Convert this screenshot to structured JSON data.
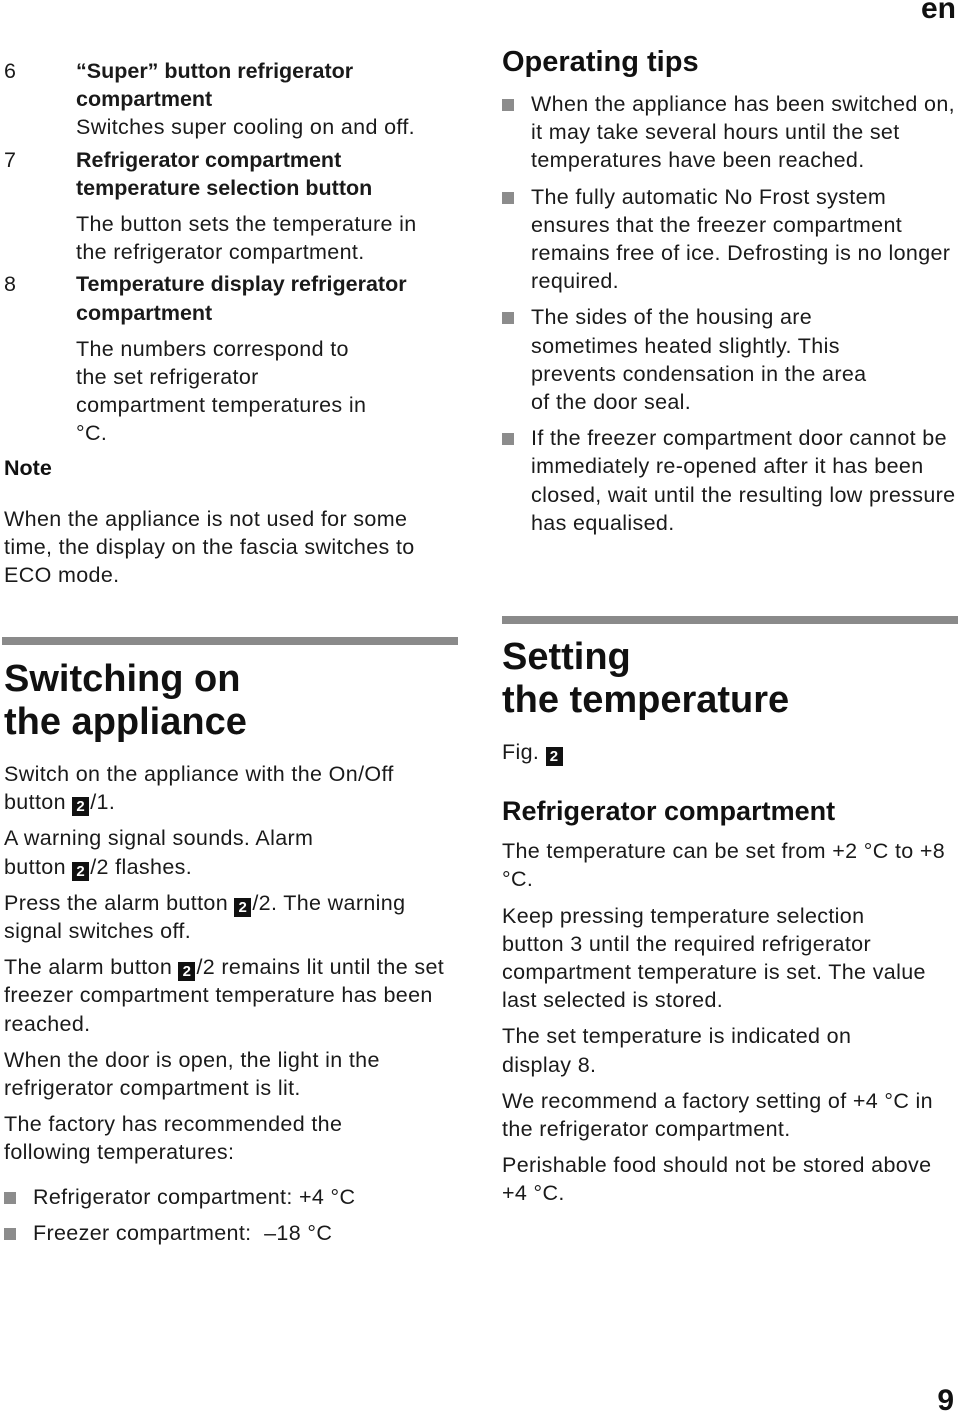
{
  "header": {
    "language": "en"
  },
  "footer": {
    "page_number": "9"
  },
  "left": {
    "definitions": [
      {
        "num": "6",
        "title": "“Super” button refrigerator compartment",
        "desc": "Switches super cooling on and off."
      },
      {
        "num": "7",
        "title": "Refrigerator compartment temperature selection button",
        "desc": "The button sets the temperature in the refrigerator compartment."
      },
      {
        "num": "8",
        "title": "Temperature display refrigerator compartment",
        "desc": "The numbers correspond to the set refrigerator compartment temperatures in °C."
      }
    ],
    "note": {
      "label": "Note",
      "text": "When the appliance is not used for some time, the display on the fascia switches to ECO mode."
    },
    "switching_on": {
      "heading_line1": "Switching on",
      "heading_line2": "the appliance",
      "p1_pre": "Switch on the appliance with the On/Off button ",
      "p1_post": "/1.",
      "p2_pre": "A warning signal sounds. Alarm button ",
      "p2_post": "/2 flashes.",
      "p3_pre": "Press the alarm button ",
      "p3_post": "/2. The warning signal switches off.",
      "p4_pre": "The alarm button ",
      "p4_post": "/2 remains lit until the set freezer compartment temperature has been reached.",
      "p5": "When the door is open, the light in the refrigerator compartment is lit.",
      "p6": "The factory has recommended the following temperatures:",
      "fig_ref": "2",
      "recommended": [
        "Refrigerator compartment: +4 °C",
        "Freezer compartment:  –18 °C"
      ]
    }
  },
  "right": {
    "operating_tips": {
      "heading": "Operating tips",
      "items": [
        "When the appliance has been switched on, it may take several hours until the set temperatures have been reached.",
        "The fully automatic No Frost system ensures that the freezer compartment remains free of ice. Defrosting is no longer required.",
        "The sides of the housing are sometimes heated slightly. This prevents condensation in the area of the door seal.",
        "If the freezer compartment door cannot be immediately re-opened after it has been closed, wait until the resulting low pressure has equalised."
      ]
    },
    "setting_temperature": {
      "heading_line1": "Setting",
      "heading_line2": "the temperature",
      "fig_label": "Fig. ",
      "fig_ref": "2",
      "sub_heading": "Refrigerator compartment",
      "paragraphs": [
        "The temperature can be set from +2 °C to +8 °C.",
        "Keep pressing temperature selection button 3 until the required refrigerator compartment temperature is set. The value last selected is stored.",
        "The set temperature is indicated on display 8.",
        "We recommend a factory setting of +4 °C in the refrigerator compartment.",
        "Perishable food should not be stored above +4 °C."
      ]
    }
  },
  "colors": {
    "rule": "#8a8a8a",
    "bullet": "#8c8c8c",
    "text": "#111111"
  }
}
